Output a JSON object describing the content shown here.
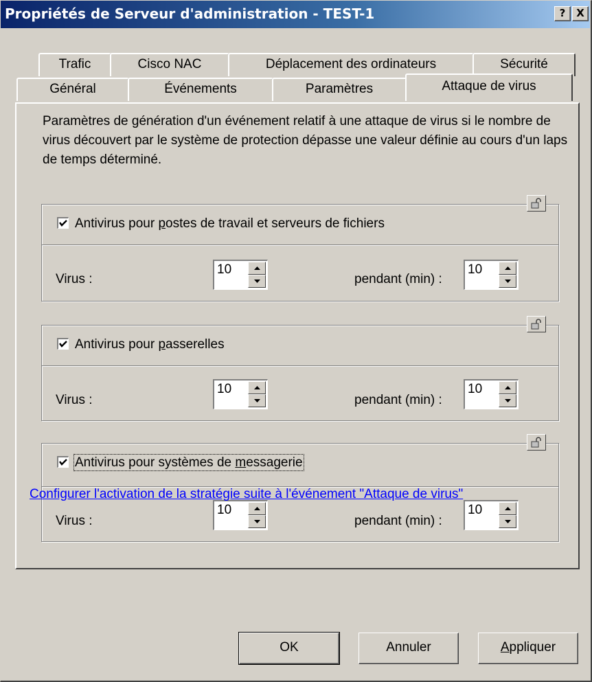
{
  "window": {
    "title": "Propriétés de Serveur d'administration - TEST-1",
    "help_button": "?",
    "close_button": "X"
  },
  "tabs_row1": [
    "Trafic",
    "Cisco NAC",
    "Déplacement des ordinateurs",
    "Sécurité"
  ],
  "tabs_row2": [
    "Général",
    "Événements",
    "Paramètres",
    "Attaque de virus"
  ],
  "active_tab": "Attaque de virus",
  "description": "Paramètres de génération d'un événement relatif à une attaque de virus si le nombre de virus découvert par le système de protection dépasse une valeur définie au cours d'un laps de temps déterminé.",
  "groups": [
    {
      "label_before": "Antivirus pour ",
      "label_accel": "p",
      "label_after": "ostes de travail et serveurs de fichiers",
      "checked": true,
      "virus_label": "Virus :",
      "virus_value": "10",
      "period_label": "pendant (min) :",
      "period_value": "10"
    },
    {
      "label_before": "Antivirus pour ",
      "label_accel": "p",
      "label_after": "asserelles",
      "checked": true,
      "virus_label": "Virus :",
      "virus_value": "10",
      "period_label": "pendant (min) :",
      "period_value": "10"
    },
    {
      "label_before": "Antivirus pour systèmes de ",
      "label_accel": "m",
      "label_after": "essagerie",
      "checked": true,
      "virus_label": "Virus :",
      "virus_value": "10",
      "period_label": "pendant (min) :",
      "period_value": "10"
    }
  ],
  "link_text": "Configurer l'activation de la stratégie suite à l'événement \"Attaque de virus\"",
  "buttons": {
    "ok": "OK",
    "cancel": "Annuler",
    "apply_accel": "A",
    "apply_rest": "ppliquer"
  }
}
